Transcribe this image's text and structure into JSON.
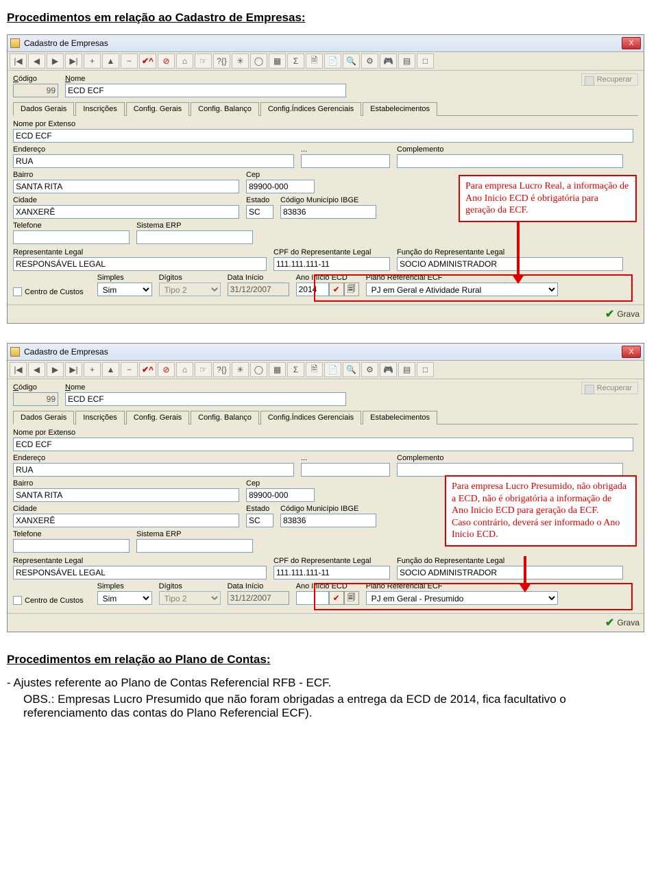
{
  "doc": {
    "title": "Procedimentos em relação ao Cadastro de Empresas:",
    "section2_title": "Procedimentos em relação ao Plano de Contas:",
    "bullet1": "- Ajustes referente ao Plano de Contas Referencial RFB - ECF.",
    "obs": "OBS.: Empresas Lucro Presumido que não foram obrigadas a entrega da ECD de 2014, fica facultativo o referenciamento das contas do Plano Referencial ECF)."
  },
  "window": {
    "title": "Cadastro de Empresas",
    "close_x": "X",
    "recuperar": "Recuperar",
    "grava": "Grava"
  },
  "toolbar": {
    "first": "|◀",
    "prev": "◀",
    "next": "▶",
    "last": "▶|",
    "plus": "+",
    "up": "▲",
    "minus": "−",
    "check": "✔^",
    "forbid": "⊘",
    "b10": "⌂",
    "b11": "☞",
    "b12": "?{}",
    "b13": "✳",
    "b14": "◯",
    "b15": "▦",
    "b16": "Σ",
    "b17": "🗎",
    "b18": "📄",
    "b19": "🔍",
    "b20": "⚙",
    "b21": "🎮",
    "b22": "▤",
    "b23": "□"
  },
  "labels": {
    "codigo": "Código",
    "nome": "Nome",
    "nome_ext": "Nome por Extenso",
    "endereco": "Endereço",
    "dots": "...",
    "complemento": "Complemento",
    "bairro": "Bairro",
    "cep": "Cep",
    "cidade": "Cidade",
    "estado": "Estado",
    "cod_mun": "Código Município IBGE",
    "telefone": "Telefone",
    "sistema_erp": "Sistema ERP",
    "repr": "Representante Legal",
    "cpf_repr": "CPF do Representante Legal",
    "funcao_repr": "Função do Representante Legal",
    "centro": "Centro de Custos",
    "simples": "Simples",
    "digitos": "Dígitos",
    "data_inicio": "Data Início",
    "ano_ecd": "Ano Início ECD",
    "plano_ecf": "Plano Referencial ECF"
  },
  "tabs": {
    "t1": "Dados Gerais",
    "t2": "Inscrições",
    "t3": "Config. Gerais",
    "t4": "Config. Balanço",
    "t5": "Config.Índices Gerenciais",
    "t6": "Estabelecimentos"
  },
  "form": {
    "codigo": "99",
    "nome": "ECD ECF",
    "nome_ext": "ECD ECF",
    "endereco": "RUA",
    "complemento": "",
    "bairro": "SANTA RITA",
    "cep": "89900-000",
    "cidade": "XANXERÊ",
    "estado": "SC",
    "cod_mun": "83836",
    "telefone": "",
    "sistema_erp": "",
    "repr": "RESPONSÁVEL LEGAL",
    "cpf_repr": "111.111.111-11",
    "funcao_repr": "SOCIO ADMINISTRADOR",
    "simples": "Sim",
    "digitos": "Tipo 2",
    "data_inicio": "31/12/2007",
    "ano_ecd_1": "2014",
    "ano_ecd_2": "",
    "plano_ecf_1": "PJ em Geral e Atividade Rural",
    "plano_ecf_2": "PJ em Geral - Presumido"
  },
  "callouts": {
    "c1": "Para empresa Lucro Real, a informação de Ano Inicio ECD é obrigatória para geração da ECF.",
    "c2": "Para empresa Lucro Presumido, não obrigada a ECD, não é obrigatória a informação de Ano Inicio ECD para geração da ECF.\nCaso contrário, deverá ser informado o Ano Inicio ECD."
  }
}
